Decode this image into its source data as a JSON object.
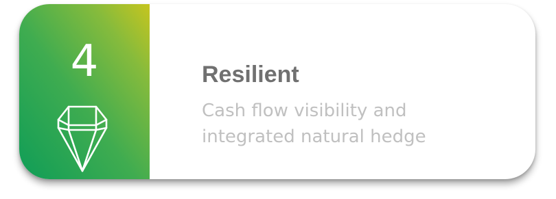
{
  "badge": {
    "number": "4",
    "icon": "gem-icon",
    "gradient_colors": [
      "#0f9d57",
      "#3fac50",
      "#86bb3c",
      "#c6c51f"
    ]
  },
  "content": {
    "title": "Resilient",
    "description_lines": [
      "Cash flow visibility and",
      "integrated natural hedge"
    ]
  },
  "colors": {
    "title": "#707070",
    "description": "#c0c0c0",
    "card_background": "#ffffff"
  }
}
